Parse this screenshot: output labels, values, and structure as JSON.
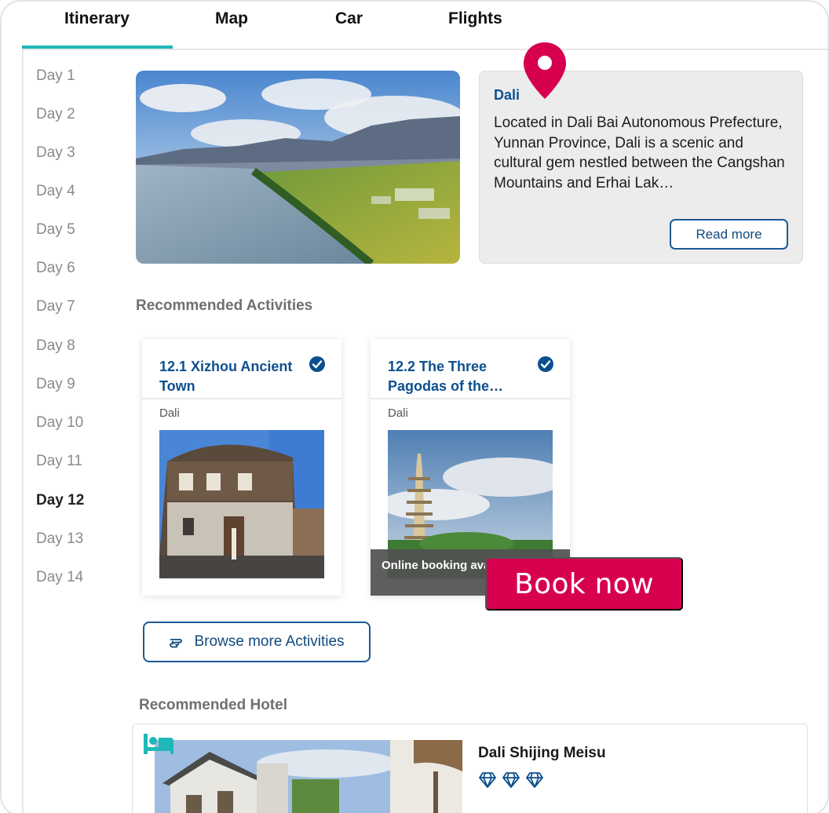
{
  "tabs": [
    {
      "label": "Itinerary",
      "active": true
    },
    {
      "label": "Map",
      "active": false
    },
    {
      "label": "Car",
      "active": false
    },
    {
      "label": "Flights",
      "active": false
    }
  ],
  "days": [
    "Day 1",
    "Day 2",
    "Day 3",
    "Day 4",
    "Day 5",
    "Day 6",
    "Day 7",
    "Day 8",
    "Day 9",
    "Day 10",
    "Day 11",
    "Day 12",
    "Day 13",
    "Day 14"
  ],
  "active_day": "Day 12",
  "destination": {
    "title": "Dali",
    "description": "Located in Dali Bai Autonomous Prefecture, Yunnan Province, Dali is a scenic and cultural gem nestled between the Cangshan Mountains and Erhai Lak…",
    "read_more_label": "Read more"
  },
  "activities": {
    "section_title": "Recommended Activities",
    "items": [
      {
        "title": "12.1 Xizhou Ancient Town",
        "location": "Dali",
        "selected": true,
        "overlay": ""
      },
      {
        "title": "12.2 The Three Pagodas of the…",
        "location": "Dali",
        "selected": true,
        "overlay": "Online booking available"
      }
    ],
    "book_now_label": "Book now",
    "browse_label": "Browse more Activities"
  },
  "hotel": {
    "section_title": "Recommended Hotel",
    "name": "Dali Shijing Meisu",
    "rating_diamonds": 3
  },
  "colors": {
    "accent_teal": "#1fb8b8",
    "link_blue": "#0d4f8e",
    "book_now": "#d6004f",
    "pin": "#d6004f"
  }
}
